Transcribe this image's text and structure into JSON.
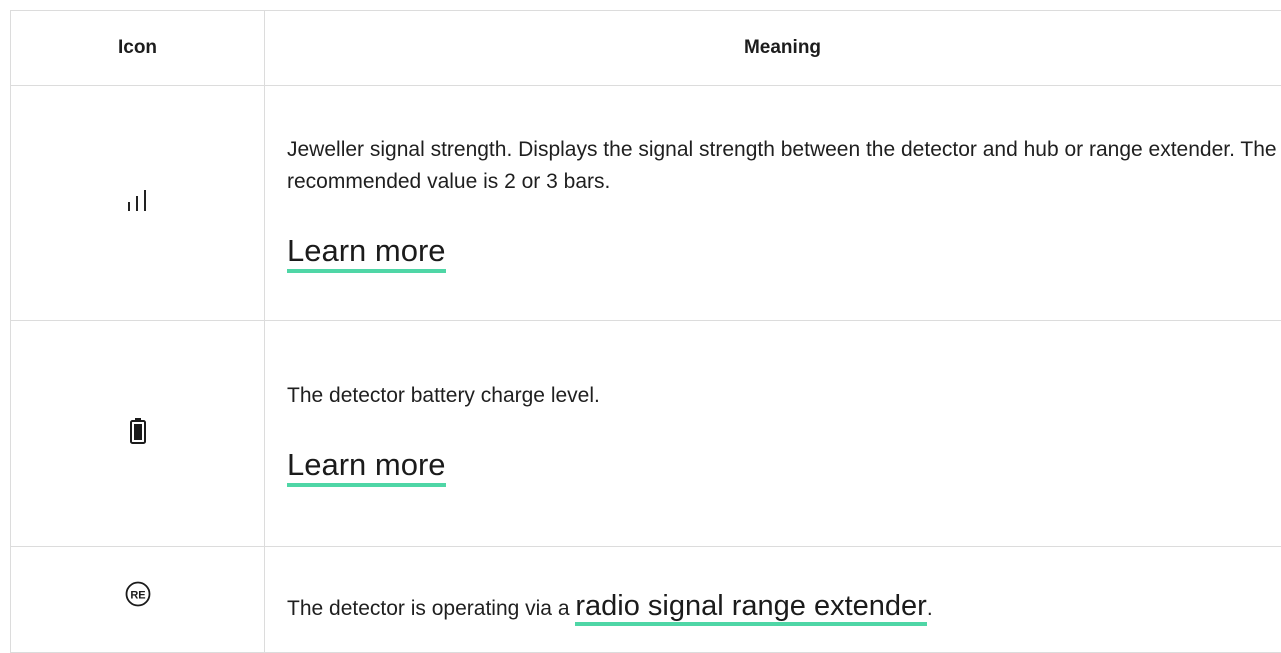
{
  "table": {
    "headers": {
      "icon": "Icon",
      "meaning": "Meaning"
    },
    "rows": [
      {
        "icon_name": "signal-strength-icon",
        "description": "Jeweller signal strength. Displays the signal strength between the detector and hub or range extender. The recommended value is 2 or 3 bars.",
        "link_label": "Learn more"
      },
      {
        "icon_name": "battery-icon",
        "description": "The detector battery charge level.",
        "link_label": "Learn more"
      },
      {
        "icon_name": "range-extender-icon",
        "icon_text": "RE",
        "description_prefix": "The detector is operating via a ",
        "link_label": "radio signal range extender",
        "description_suffix": "."
      }
    ]
  },
  "colors": {
    "link_underline": "#4fd6a6",
    "border": "#dcdcdc",
    "text": "#1d1d1d"
  }
}
